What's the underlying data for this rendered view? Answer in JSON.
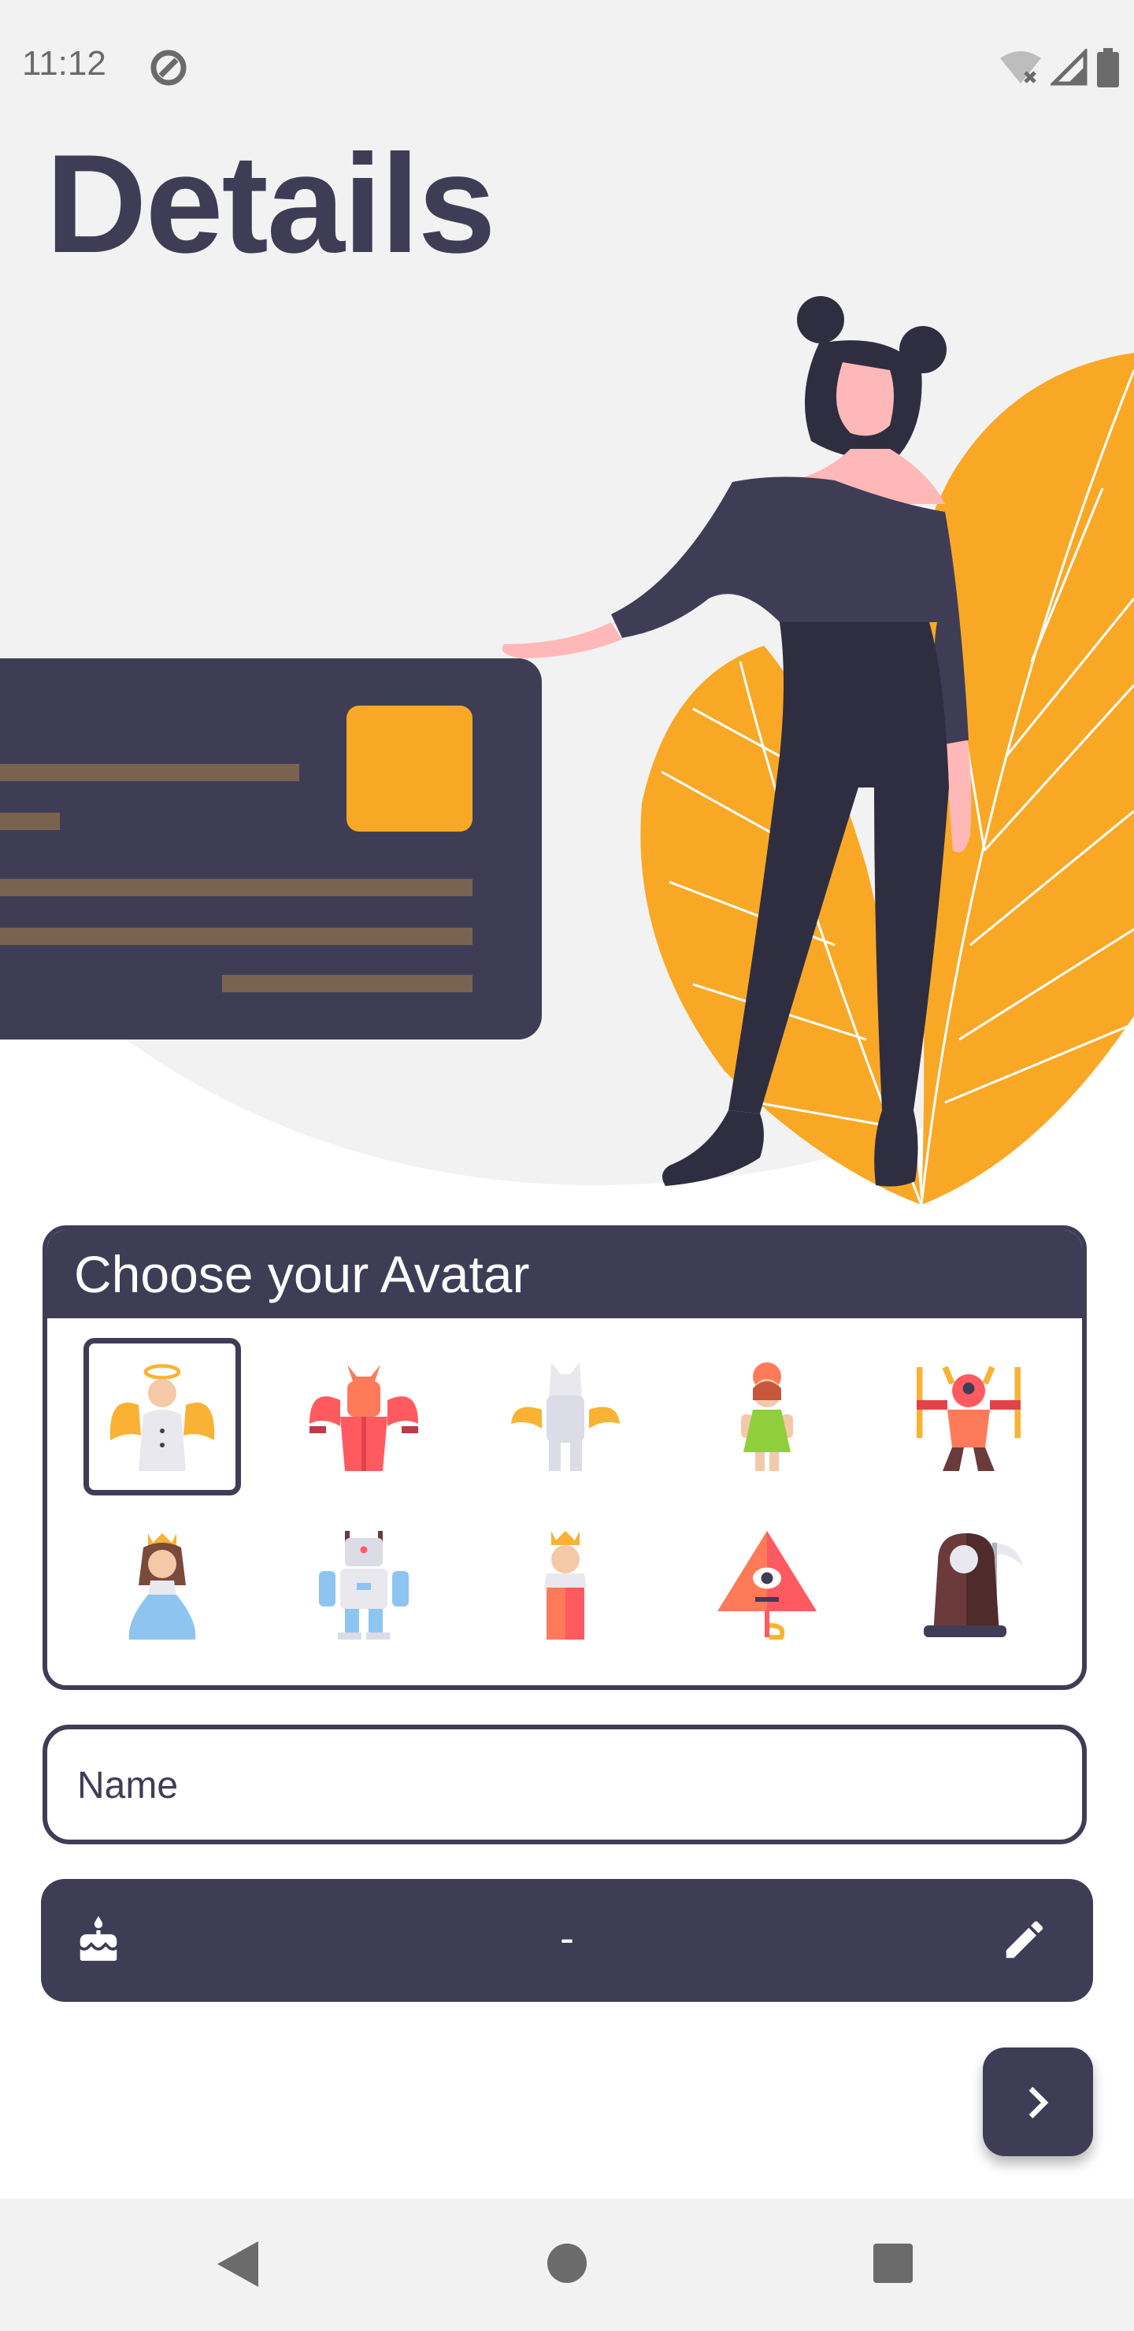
{
  "status_bar": {
    "time": "11:12"
  },
  "page_title": "Details",
  "avatar_section": {
    "header": "Choose your Avatar",
    "avatars": [
      "angel-icon",
      "demon-icon",
      "pegasus-icon",
      "fairy-icon",
      "genie-icon",
      "princess-icon",
      "robot-icon",
      "king-icon",
      "cyclops-icon",
      "reaper-icon"
    ],
    "selected_index": 0
  },
  "name_field": {
    "placeholder": "Name",
    "value": ""
  },
  "birthday": {
    "value": "-"
  },
  "colors": {
    "primary": "#3f3d56",
    "accent": "#f9a826",
    "background": "#f2f2f2"
  }
}
